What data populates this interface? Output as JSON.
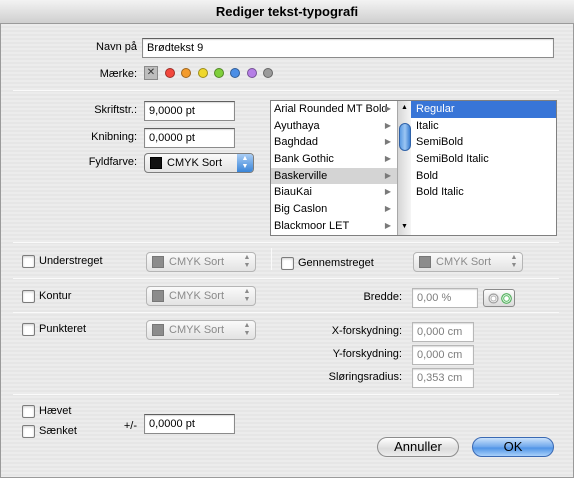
{
  "window": {
    "title": "Rediger tekst-typografi"
  },
  "name": {
    "label": "Navn på",
    "value": "Brødtekst 9"
  },
  "tag": {
    "label": "Mærke:",
    "none_glyph": "✕",
    "colors": [
      "#f2473c",
      "#f39b2c",
      "#efd72c",
      "#7fcf3b",
      "#4b8ee6",
      "#b57ee6",
      "#9b9b9b"
    ]
  },
  "font_size": {
    "label": "Skriftstr.:",
    "value": "9,0000 pt"
  },
  "kerning": {
    "label": "Knibning:",
    "value": "0,0000 pt"
  },
  "fill": {
    "label": "Fyldfarve:",
    "value": "CMYK Sort"
  },
  "fonts": {
    "families": [
      "Arial Rounded MT Bold",
      "Ayuthaya",
      "Baghdad",
      "Bank Gothic",
      "Baskerville",
      "BiauKai",
      "Big Caslon",
      "Blackmoor LET"
    ],
    "selected_family": "Baskerville",
    "styles": [
      "Regular",
      "Italic",
      "SemiBold",
      "SemiBold Italic",
      "Bold",
      "Bold Italic"
    ],
    "selected_style": "Regular",
    "submenu_arrow": "▶"
  },
  "underline": {
    "label": "Understreget",
    "color": "CMYK Sort"
  },
  "strikethrough": {
    "label": "Gennemstreget",
    "color": "CMYK Sort"
  },
  "outline": {
    "label": "Kontur",
    "color": "CMYK Sort",
    "width_label": "Bredde:",
    "width_value": "0,00 %"
  },
  "dotted": {
    "label": "Punkteret",
    "color": "CMYK Sort"
  },
  "shadow": {
    "x_label": "X-forskydning:",
    "x_value": "0,000 cm",
    "y_label": "Y-forskydning:",
    "y_value": "0,000 cm",
    "blur_label": "Sløringsradius:",
    "blur_value": "0,353 cm"
  },
  "raised": {
    "label": "Hævet"
  },
  "lowered": {
    "label": "Sænket"
  },
  "offset": {
    "label": "+/-",
    "value": "0,0000 pt"
  },
  "buttons": {
    "cancel": "Annuller",
    "ok": "OK"
  },
  "arrows": {
    "up": "▲",
    "down": "▼"
  }
}
